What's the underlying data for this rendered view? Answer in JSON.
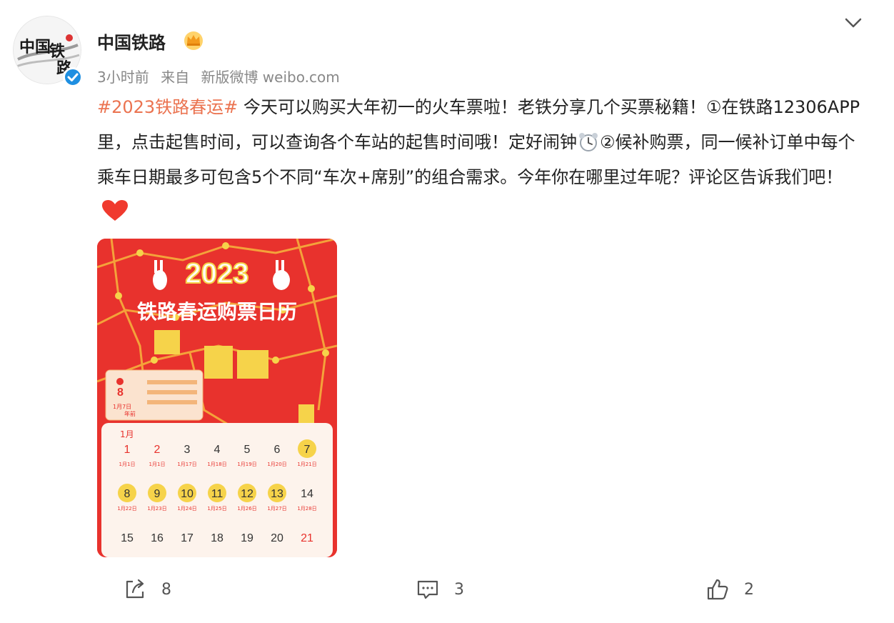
{
  "post": {
    "author": "中国铁路",
    "time": "3小时前",
    "source_prefix": "来自",
    "source": "新版微博 weibo.com",
    "hashtag": "#2023铁路春运#",
    "text_part1": " 今天可以购买大年初一的火车票啦！老铁分享几个买票秘籍！①在铁路12306APP里，点击起售时间，可以查询各个车站的起售时间哦！定好闹钟",
    "text_part2": "②候补购票，同一候补订单中每个乘车日期最多可包含5个不同“车次+席别”的组合需求。今年你在哪里过年呢？评论区告诉我们吧！",
    "icons": [
      "alarm-clock-emoji",
      "heart-emoji",
      "crown-badge",
      "verified-badge",
      "chevron-down"
    ]
  },
  "image_text": {
    "year": "2023",
    "title": "铁路春运购票日历",
    "month": "1月",
    "highlight_day": "8",
    "highlight_date": "1月7日",
    "highlight_note": "年前",
    "calendar_rows": [
      [
        {
          "d": "1",
          "s": "1月1日",
          "red": true
        },
        {
          "d": "2",
          "s": "1月1日",
          "red": true
        },
        {
          "d": "3",
          "s": "1月17日"
        },
        {
          "d": "4",
          "s": "1月18日"
        },
        {
          "d": "5",
          "s": "1月19日"
        },
        {
          "d": "6",
          "s": "1月20日"
        },
        {
          "d": "7",
          "s": "1月21日",
          "hl": true
        }
      ],
      [
        {
          "d": "8",
          "s": "1月22日",
          "hl": true
        },
        {
          "d": "9",
          "s": "1月23日",
          "hl": true
        },
        {
          "d": "10",
          "s": "1月24日",
          "hl": true
        },
        {
          "d": "11",
          "s": "1月25日",
          "hl": true
        },
        {
          "d": "12",
          "s": "1月26日",
          "hl": true
        },
        {
          "d": "13",
          "s": "1月27日",
          "hl": true
        },
        {
          "d": "14",
          "s": "1月28日"
        }
      ],
      [
        {
          "d": "15",
          "s": ""
        },
        {
          "d": "16",
          "s": ""
        },
        {
          "d": "17",
          "s": ""
        },
        {
          "d": "18",
          "s": ""
        },
        {
          "d": "19",
          "s": ""
        },
        {
          "d": "20",
          "s": ""
        },
        {
          "d": "21",
          "s": "",
          "red": true
        }
      ]
    ]
  },
  "actions": {
    "repost_count": "8",
    "comment_count": "3",
    "like_count": "2"
  },
  "colors": {
    "hashtag": "#eb7350",
    "poster_red": "#e8322d",
    "poster_yellow": "#f6d34a",
    "verified": "#1e8fe1"
  }
}
